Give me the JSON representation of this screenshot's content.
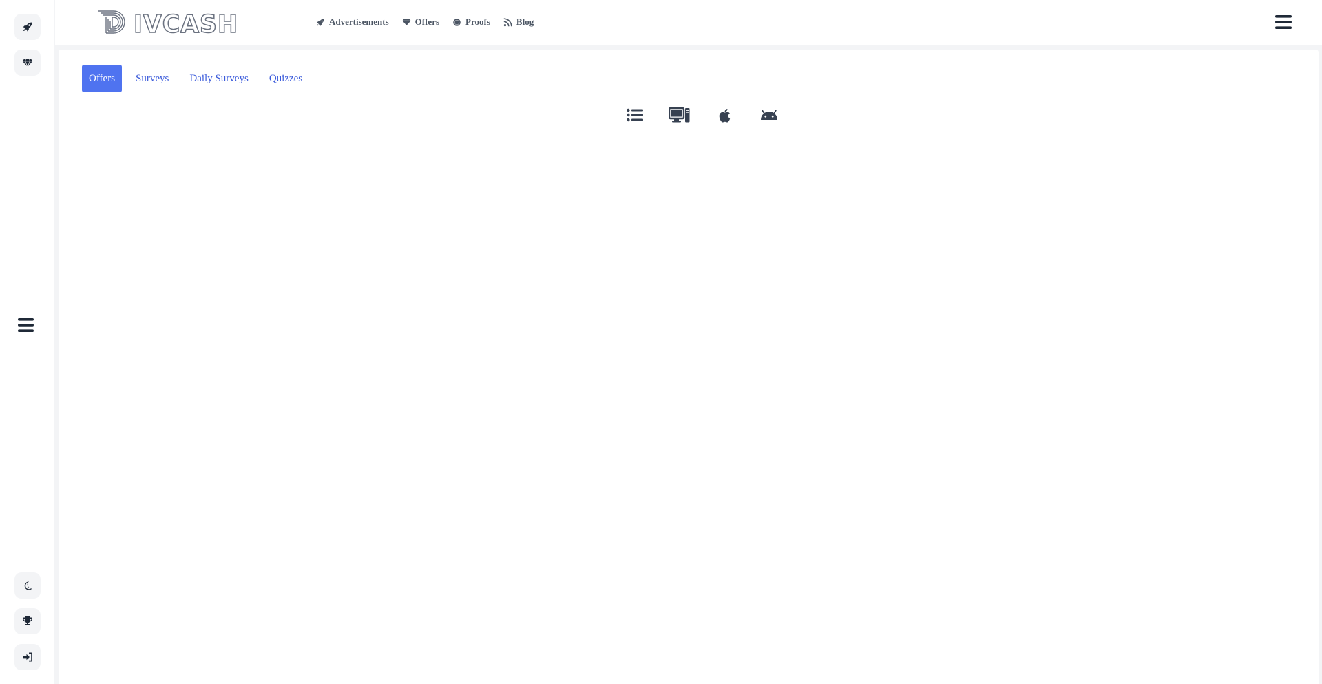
{
  "brand": {
    "logo_text": "DIVCASH"
  },
  "sidebar": {
    "top_icons": [
      "rocket-icon",
      "gem-icon"
    ],
    "middle_icon": "menu-icon",
    "bottom_icons": [
      "moon-icon",
      "trophy-icon",
      "sign-in-icon"
    ]
  },
  "header": {
    "nav": [
      {
        "label": "Advertisements",
        "icon": "rocket-icon"
      },
      {
        "label": "Offers",
        "icon": "gem-icon"
      },
      {
        "label": "Proofs",
        "icon": "circle-icon"
      },
      {
        "label": "Blog",
        "icon": "rss-icon"
      }
    ],
    "menu_icon": "hamburger-icon"
  },
  "tabs": [
    {
      "label": "Offers",
      "active": true
    },
    {
      "label": "Surveys",
      "active": false
    },
    {
      "label": "Daily Surveys",
      "active": false
    },
    {
      "label": "Quizzes",
      "active": false
    }
  ],
  "platform_filters": [
    "list-icon",
    "desktop-icon",
    "apple-icon",
    "android-icon"
  ],
  "colors": {
    "accent": "#4f73f0",
    "link": "#3b5bdb",
    "icon": "#374151",
    "background": "#f3f4f6"
  }
}
